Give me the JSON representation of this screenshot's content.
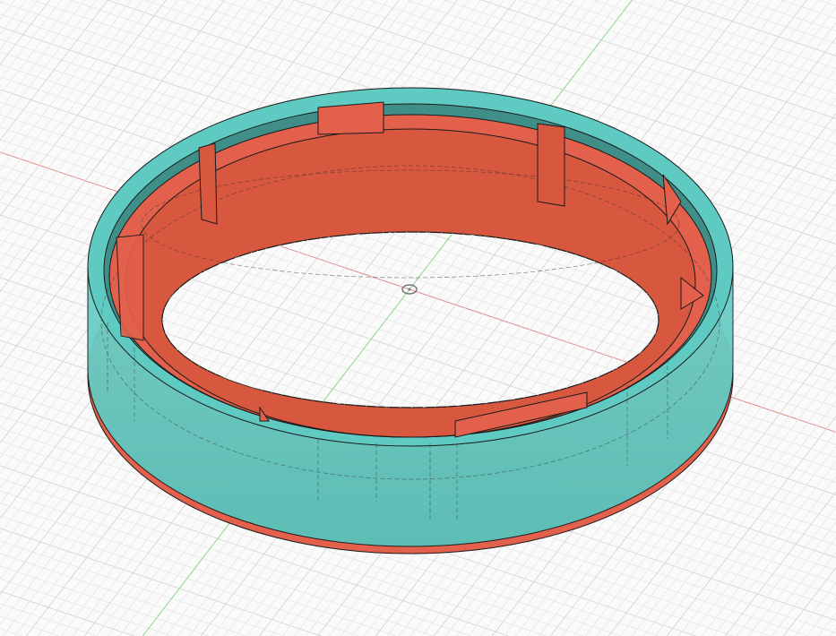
{
  "viewport": {
    "background": "#fafafa",
    "grid_minor": "#e6e6e6",
    "grid_major": "#d2d2d2",
    "x_axis_color": "#e88a8a",
    "y_axis_color": "#8ad88a"
  },
  "model": {
    "outer_body_color": "#5fcac1",
    "outer_body_dark": "#4aa8a0",
    "inner_ring_color": "#e2604c",
    "inner_ring_dark": "#c94e3c",
    "edge_color": "#1a1a1a"
  },
  "icons": {
    "origin": "origin-marker-icon"
  }
}
